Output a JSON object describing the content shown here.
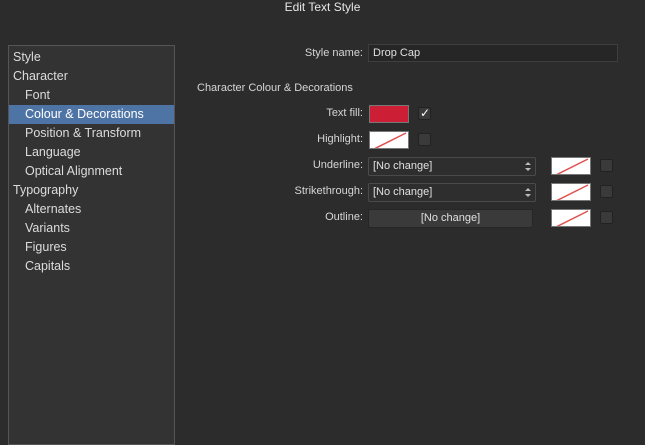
{
  "window": {
    "title": "Edit Text Style"
  },
  "sidebar": {
    "items": [
      {
        "label": "Style",
        "level": 0,
        "selected": false
      },
      {
        "label": "Character",
        "level": 0,
        "selected": false
      },
      {
        "label": "Font",
        "level": 1,
        "selected": false
      },
      {
        "label": "Colour & Decorations",
        "level": 1,
        "selected": true
      },
      {
        "label": "Position & Transform",
        "level": 1,
        "selected": false
      },
      {
        "label": "Language",
        "level": 1,
        "selected": false
      },
      {
        "label": "Optical Alignment",
        "level": 1,
        "selected": false
      },
      {
        "label": "Typography",
        "level": 0,
        "selected": false
      },
      {
        "label": "Alternates",
        "level": 1,
        "selected": false
      },
      {
        "label": "Variants",
        "level": 1,
        "selected": false
      },
      {
        "label": "Figures",
        "level": 1,
        "selected": false
      },
      {
        "label": "Capitals",
        "level": 1,
        "selected": false
      }
    ]
  },
  "form": {
    "style_name_label": "Style name:",
    "style_name_value": "Drop Cap",
    "section_title": "Character Colour & Decorations",
    "text_fill_label": "Text fill:",
    "text_fill_color": "#cc1f35",
    "text_fill_checked": "✓",
    "highlight_label": "Highlight:",
    "underline_label": "Underline:",
    "underline_value": "[No change]",
    "strikethrough_label": "Strikethrough:",
    "strikethrough_value": "[No change]",
    "outline_label": "Outline:",
    "outline_value": "[No change]"
  },
  "colors": {
    "selection": "#4e74a6",
    "none_slash": "#e05050"
  }
}
